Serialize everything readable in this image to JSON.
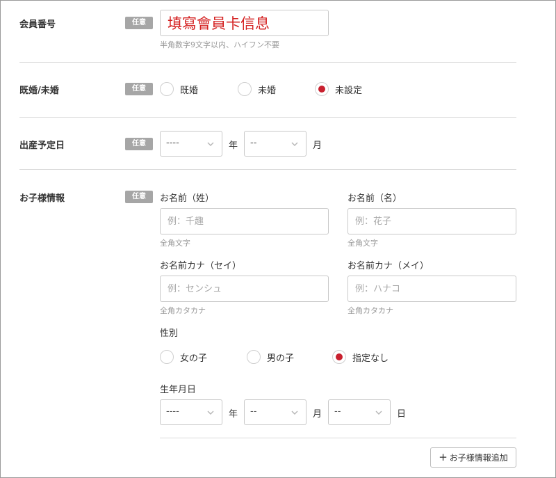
{
  "badge_label": "任意",
  "member_number": {
    "label": "会員番号",
    "value": "填寫會員卡信息",
    "hint": "半角数字9文字以内、ハイフン不要"
  },
  "marital": {
    "label": "既婚/未婚",
    "options": [
      "既婚",
      "未婚",
      "未設定"
    ],
    "selected": "未設定"
  },
  "due_date": {
    "label": "出産予定日",
    "year_value": "----",
    "month_value": "--",
    "year_unit": "年",
    "month_unit": "月"
  },
  "child_info": {
    "label": "お子様情報",
    "last_name": {
      "label": "お名前（姓）",
      "placeholder": "例：千趣",
      "hint": "全角文字"
    },
    "first_name": {
      "label": "お名前（名）",
      "placeholder": "例：花子",
      "hint": "全角文字"
    },
    "last_name_kana": {
      "label": "お名前カナ（セイ）",
      "placeholder": "例：センシュ",
      "hint": "全角カタカナ"
    },
    "first_name_kana": {
      "label": "お名前カナ（メイ）",
      "placeholder": "例：ハナコ",
      "hint": "全角カタカナ"
    },
    "gender": {
      "label": "性別",
      "options": [
        "女の子",
        "男の子",
        "指定なし"
      ],
      "selected": "指定なし"
    },
    "birthdate": {
      "label": "生年月日",
      "year_value": "----",
      "month_value": "--",
      "day_value": "--",
      "year_unit": "年",
      "month_unit": "月",
      "day_unit": "日"
    },
    "add_button_label": "お子様情報追加"
  },
  "colors": {
    "accent_red": "#c8202e",
    "badge_gray": "#a6a6a6",
    "input_text_red": "#d42020"
  }
}
